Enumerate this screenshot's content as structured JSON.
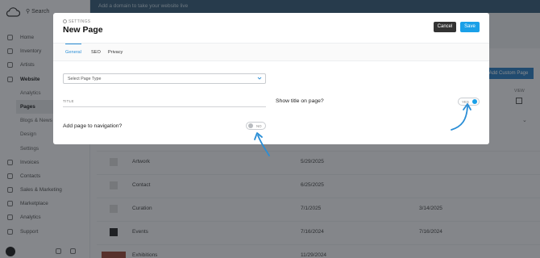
{
  "sidebar": {
    "search_label": "Search",
    "items": [
      {
        "label": "Home",
        "icon": "home-icon",
        "kind": "main"
      },
      {
        "label": "Inventory",
        "icon": "box-icon",
        "kind": "main"
      },
      {
        "label": "Artists",
        "icon": "brush-icon",
        "kind": "main"
      },
      {
        "label": "Website",
        "icon": "website-icon",
        "kind": "main-bold"
      },
      {
        "label": "Analytics",
        "kind": "sub"
      },
      {
        "label": "Pages",
        "kind": "active"
      },
      {
        "label": "Blogs & News",
        "kind": "sub"
      },
      {
        "label": "Design",
        "kind": "sub"
      },
      {
        "label": "Settings",
        "kind": "sub"
      },
      {
        "label": "Invoices",
        "icon": "invoice-icon",
        "kind": "main"
      },
      {
        "label": "Contacts",
        "icon": "contacts-icon",
        "kind": "main"
      },
      {
        "label": "Sales & Marketing",
        "icon": "megaphone-icon",
        "kind": "main"
      },
      {
        "label": "Marketplace",
        "icon": "store-icon",
        "kind": "main"
      },
      {
        "label": "Analytics",
        "icon": "chart-icon",
        "kind": "main"
      },
      {
        "label": "Support",
        "icon": "help-icon",
        "kind": "main"
      }
    ]
  },
  "banner": {
    "text": "Add a domain to take your website live"
  },
  "page_actions": {
    "add_custom_page": "Add Custom Page",
    "view_label": "VIEW"
  },
  "rows": [
    {
      "name": "Artwork",
      "date1": "5/29/2025",
      "date2": "",
      "thumb": "light"
    },
    {
      "name": "Contact",
      "date1": "6/25/2025",
      "date2": "",
      "thumb": "light"
    },
    {
      "name": "Curation",
      "date1": "7/1/2025",
      "date2": "3/14/2025",
      "thumb": "light"
    },
    {
      "name": "Events",
      "date1": "7/16/2024",
      "date2": "7/16/2024",
      "thumb": "dark"
    },
    {
      "name": "Exhibitions",
      "date1": "11/29/2024",
      "date2": "",
      "thumb": "wide"
    }
  ],
  "modal": {
    "settings_label": "SETTINGS",
    "title": "New Page",
    "cancel_label": "Cancel",
    "save_label": "Save",
    "tabs": [
      {
        "label": "General",
        "active": true
      },
      {
        "label": "SEO",
        "active": false
      },
      {
        "label": "Privacy",
        "active": false
      }
    ],
    "page_type_placeholder": "Select Page Type",
    "title_field_label": "TITLE",
    "add_to_nav_question": "Add page to navigation?",
    "add_to_nav_toggle": {
      "label": "NO",
      "on": false
    },
    "show_title_question": "Show title on page?",
    "show_title_toggle": {
      "label": "YES",
      "on": true
    }
  },
  "colors": {
    "accent": "#1aa0e8",
    "toggle_on": "#1aa0e8",
    "toggle_off": "#b9bcc0",
    "annotation_arrow": "#2a8ed6",
    "cancel_button": "#333333"
  }
}
